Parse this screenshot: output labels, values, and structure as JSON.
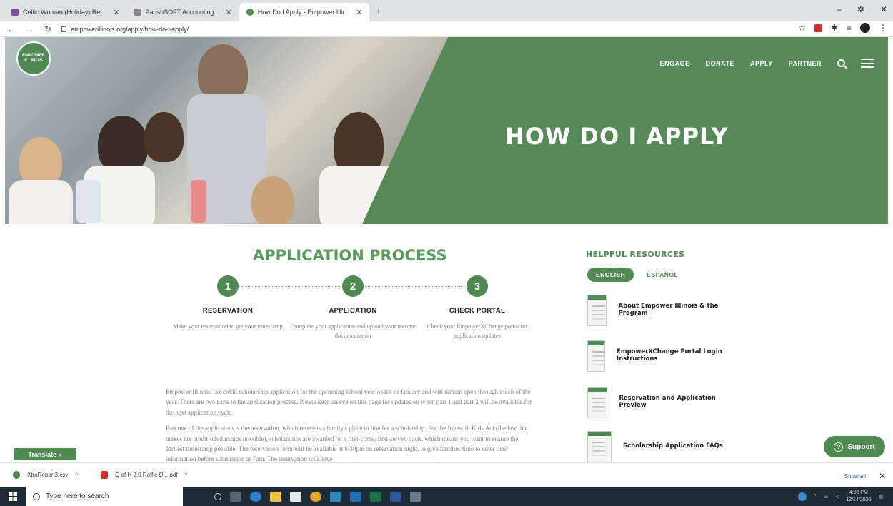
{
  "browser": {
    "tabs": [
      {
        "title": "Celtic Woman (Holiday) Rel"
      },
      {
        "title": "ParishSOFT Accounting"
      },
      {
        "title": "How Do I Apply - Empower Illir"
      }
    ],
    "url": "empowerillinois.org/apply/how-do-i-apply/"
  },
  "site": {
    "logo_text": "EMPOWER ILLINOIS",
    "nav": [
      "ENGAGE",
      "DONATE",
      "APPLY",
      "PARTNER"
    ],
    "hero_title": "HOW DO I APPLY"
  },
  "process": {
    "title": "APPLICATION PROCESS",
    "steps": [
      {
        "number": "1",
        "title": "RESERVATION",
        "desc": "Make your reservation to get your timestamp"
      },
      {
        "number": "2",
        "title": "APPLICATION",
        "desc": "Complete your application and upload your income documentation"
      },
      {
        "number": "3",
        "title": "CHECK PORTAL",
        "desc": "Check your EmpowerXChange portal for application updates"
      }
    ]
  },
  "body": {
    "p1": "Empower Illinois' tax credit scholarship application for the upcoming school year opens in January and will remain open through much of the year. There are two parts to the application process. Please keep an eye on this page for updates on when part 1 and part 2 will be available for the next application cycle",
    "p2": "Part one of the application is the reservation, which reserves a family's place in line for a scholarship. Per the Invest in Kids Act (the law that makes tax credit scholarships possible), scholarships are awarded on a first-come, first-served basis, which means you want to ensure the earliest timestamp possible. The reservation form will be available at 6:30pm on reservation night, to give families time to enter their information before submission at 7pm. The reservation will have"
  },
  "resources": {
    "title": "HELPFUL RESOURCES",
    "lang_on": "ENGLISH",
    "lang_off": "ESPAÑOL",
    "items": [
      "About Empower Illinois & the Program",
      "EmpowerXChange Portal Login Instructions",
      "Reservation and Application Preview",
      "Scholarship Application FAQs"
    ]
  },
  "widgets": {
    "support": "Support",
    "translate": "Translate »"
  },
  "downloads": {
    "files": [
      "XtraReport3.csv",
      "Q of H 2.0 Raffle D....pdf"
    ],
    "show_all": "Show all"
  },
  "taskbar": {
    "search_placeholder": "Type here to search",
    "time": "4:08 PM",
    "date": "12/14/2020"
  }
}
